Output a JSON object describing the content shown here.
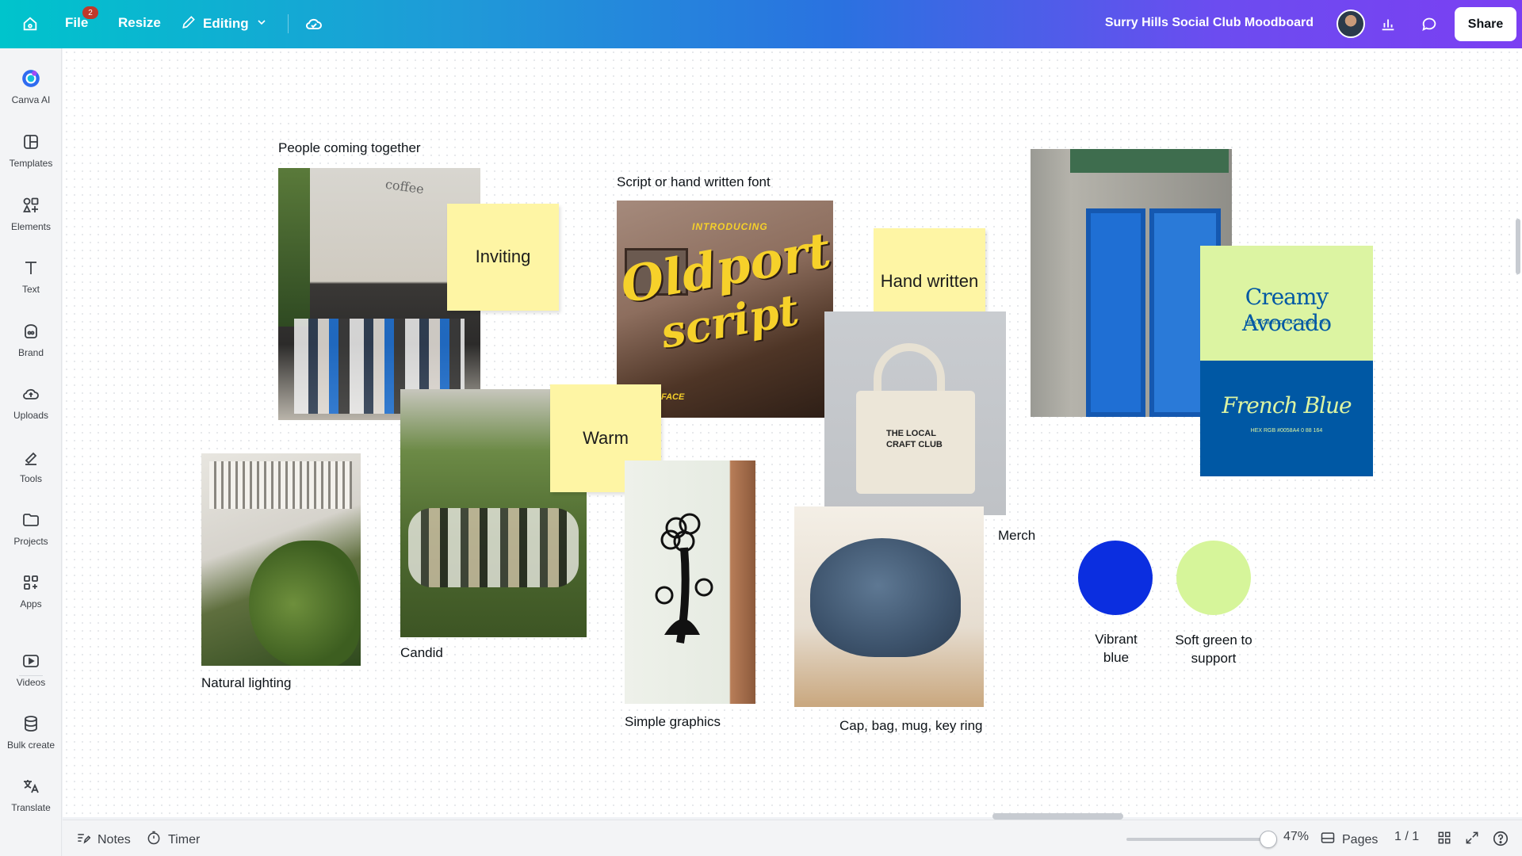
{
  "topbar": {
    "file_label": "File",
    "file_badge": "2",
    "resize_label": "Resize",
    "editing_label": "Editing",
    "design_title": "Surry Hills Social Club Moodboard",
    "share_label": "Share"
  },
  "sidebar": {
    "items": [
      {
        "label": "Canva AI",
        "icon": "canva-ai-icon"
      },
      {
        "label": "Templates",
        "icon": "templates-icon"
      },
      {
        "label": "Elements",
        "icon": "elements-icon"
      },
      {
        "label": "Text",
        "icon": "text-icon"
      },
      {
        "label": "Brand",
        "icon": "brand-icon"
      },
      {
        "label": "Uploads",
        "icon": "uploads-icon"
      },
      {
        "label": "Tools",
        "icon": "tools-icon"
      },
      {
        "label": "Projects",
        "icon": "projects-icon"
      },
      {
        "label": "Apps",
        "icon": "apps-icon"
      },
      {
        "label": "Videos",
        "icon": "videos-icon"
      },
      {
        "label": "Bulk create",
        "icon": "bulk-create-icon"
      },
      {
        "label": "Translate",
        "icon": "translate-icon"
      }
    ]
  },
  "canvas": {
    "captions": {
      "people": "People coming  together",
      "script": "Script or hand written font",
      "natural": "Natural lighting",
      "candid": "Candid",
      "simple": "Simple graphics",
      "cap": "Cap, bag, mug, key ring",
      "merch": "Merch",
      "vibrant": "Vibrant blue",
      "softgreen": "Soft green to support"
    },
    "stickies": {
      "inviting": "Inviting",
      "warm": "Warm",
      "hand": "Hand written"
    },
    "photo_text": {
      "coffee_sign": "coffee",
      "introducing": "INTRODUCING",
      "oldport": "Oldport",
      "script": "script",
      "face": "FACE",
      "tote_line1": "THE LOCAL",
      "tote_line2": "CRAFT CLUB",
      "avocado": "Creamy Avocado",
      "avocado_codes": "HEX  RGB  #DCF4A2  220 244 162",
      "french": "French Blue",
      "french_codes": "HEX  RGB  #0058A4  0 88 164"
    },
    "swatch_colors": {
      "vibrant_blue": "#0b2ee0",
      "soft_green": "#d6f59a"
    }
  },
  "bottombar": {
    "notes_label": "Notes",
    "timer_label": "Timer",
    "zoom_label": "47%",
    "pages_label": "Pages",
    "page_count": "1 / 1"
  }
}
